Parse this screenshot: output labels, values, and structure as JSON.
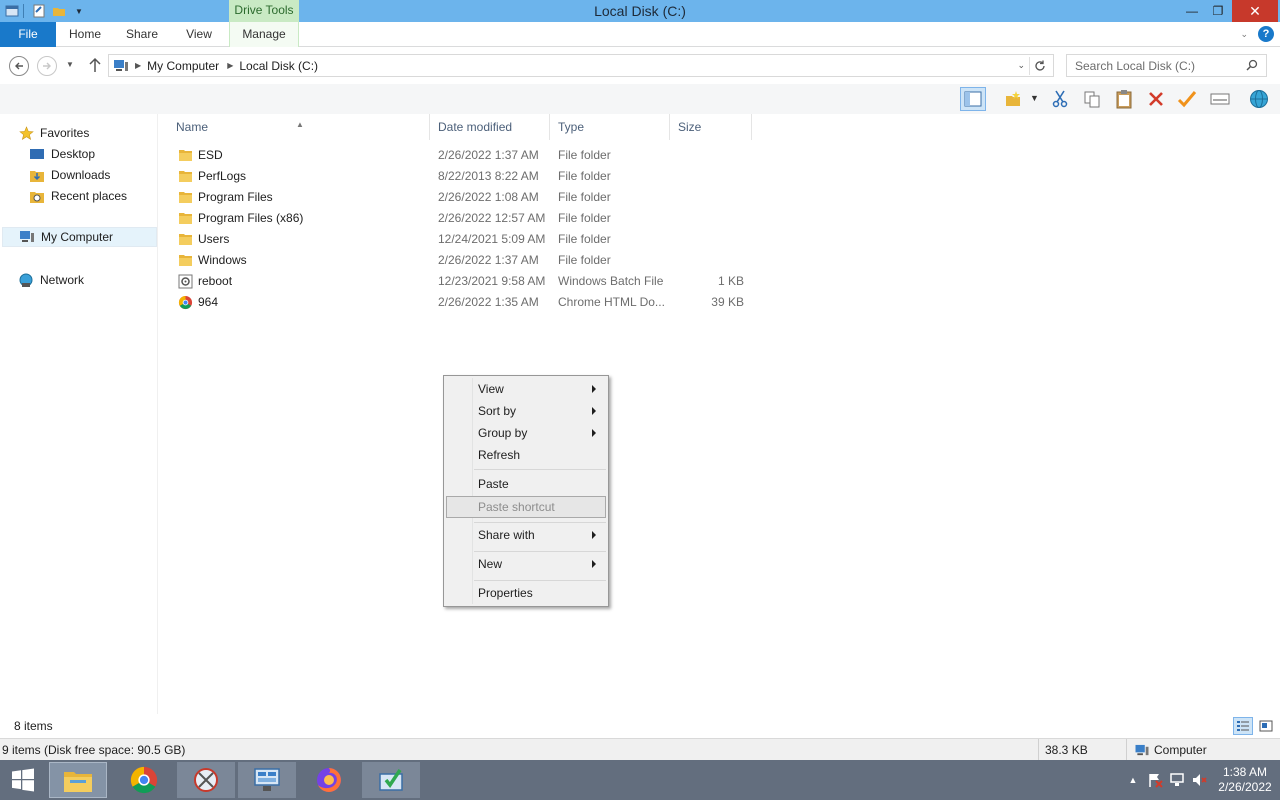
{
  "window": {
    "title": "Local Disk (C:)",
    "contextual_tab": "Drive Tools",
    "minimize": "—",
    "maximize": "❐",
    "close": "✕"
  },
  "ribbon": {
    "tabs": [
      "File",
      "Home",
      "Share",
      "View",
      "Manage"
    ],
    "help": "?"
  },
  "address": {
    "crumbs": [
      "My Computer",
      "Local Disk (C:)"
    ],
    "search_placeholder": "Search Local Disk (C:)"
  },
  "nav": {
    "favorites": "Favorites",
    "desktop": "Desktop",
    "downloads": "Downloads",
    "recent": "Recent places",
    "computer": "My Computer",
    "network": "Network"
  },
  "columns": {
    "name": "Name",
    "date": "Date modified",
    "type": "Type",
    "size": "Size"
  },
  "files": [
    {
      "name": "ESD",
      "date": "2/26/2022 1:37 AM",
      "type": "File folder",
      "size": "",
      "icon": "folder-icon"
    },
    {
      "name": "PerfLogs",
      "date": "8/22/2013 8:22 AM",
      "type": "File folder",
      "size": "",
      "icon": "folder-icon"
    },
    {
      "name": "Program Files",
      "date": "2/26/2022 1:08 AM",
      "type": "File folder",
      "size": "",
      "icon": "folder-icon"
    },
    {
      "name": "Program Files (x86)",
      "date": "2/26/2022 12:57 AM",
      "type": "File folder",
      "size": "",
      "icon": "folder-icon"
    },
    {
      "name": "Users",
      "date": "12/24/2021 5:09 AM",
      "type": "File folder",
      "size": "",
      "icon": "folder-icon"
    },
    {
      "name": "Windows",
      "date": "2/26/2022 1:37 AM",
      "type": "File folder",
      "size": "",
      "icon": "folder-icon"
    },
    {
      "name": "reboot",
      "date": "12/23/2021 9:58 AM",
      "type": "Windows Batch File",
      "size": "1 KB",
      "icon": "batch-file-icon"
    },
    {
      "name": "964",
      "date": "2/26/2022 1:35 AM",
      "type": "Chrome HTML Do...",
      "size": "39 KB",
      "icon": "chrome-html-icon"
    }
  ],
  "context_menu": {
    "view": "View",
    "sort_by": "Sort by",
    "group_by": "Group by",
    "refresh": "Refresh",
    "paste": "Paste",
    "paste_shortcut": "Paste shortcut",
    "share_with": "Share with",
    "new": "New",
    "properties": "Properties"
  },
  "status": {
    "items": "8 items",
    "details": "9 items (Disk free space: 90.5 GB)",
    "size": "38.3 KB",
    "location": "Computer"
  },
  "clock": {
    "time": "1:38 AM",
    "date": "2/26/2022"
  },
  "colors": {
    "titlebar": "#6cb4ec",
    "file_tab": "#1979ca",
    "drive_tools": "#c9eac4",
    "taskbar": "#636e7e",
    "folder": "#e8b53a"
  }
}
